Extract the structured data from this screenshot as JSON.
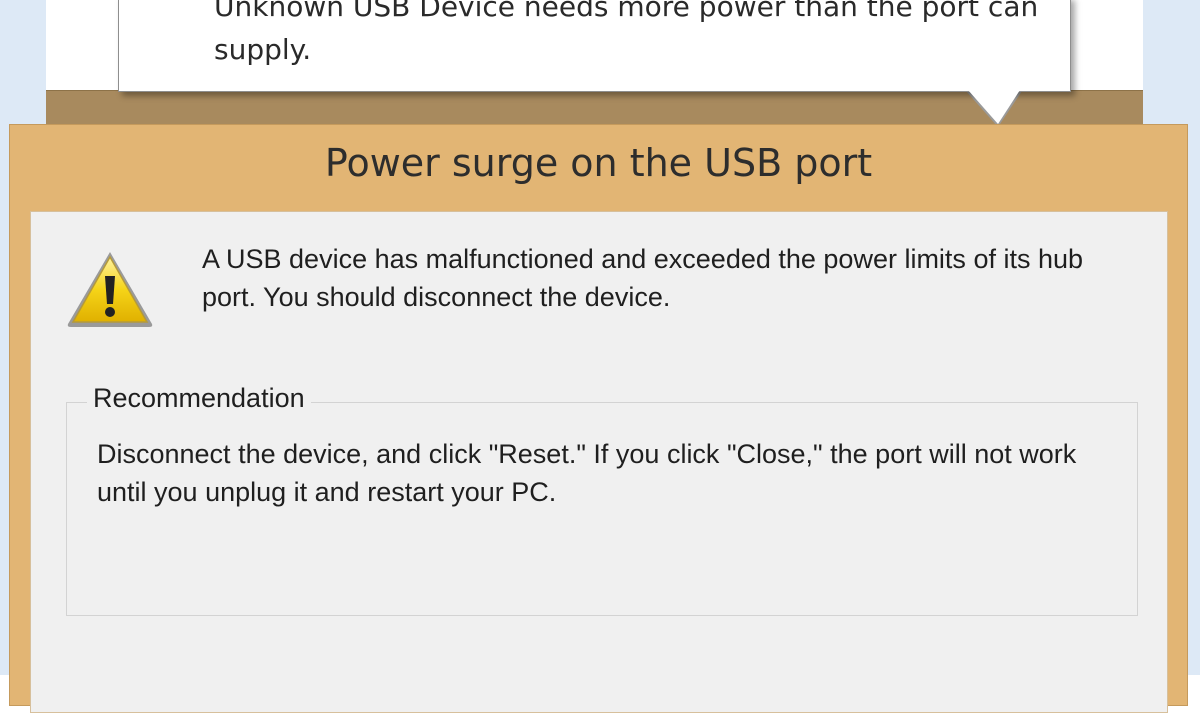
{
  "balloon": {
    "message": "Unknown USB Device needs more power than the port can supply."
  },
  "dialog": {
    "title": "Power surge on the USB port",
    "icon": "warning-icon",
    "message": "A USB device has malfunctioned and exceeded the power limits of its hub port. You should disconnect the device.",
    "recommendation": {
      "label": "Recommendation",
      "text": "Disconnect the device, and click \"Reset.\" If you click \"Close,\" the port will not work until you unplug it and restart your PC."
    }
  },
  "colors": {
    "dialog_frame": "#e2b574",
    "client_background": "#f0f0f0",
    "desktop": "#dde9f6",
    "taskbar_frame": "#a88a5e"
  }
}
